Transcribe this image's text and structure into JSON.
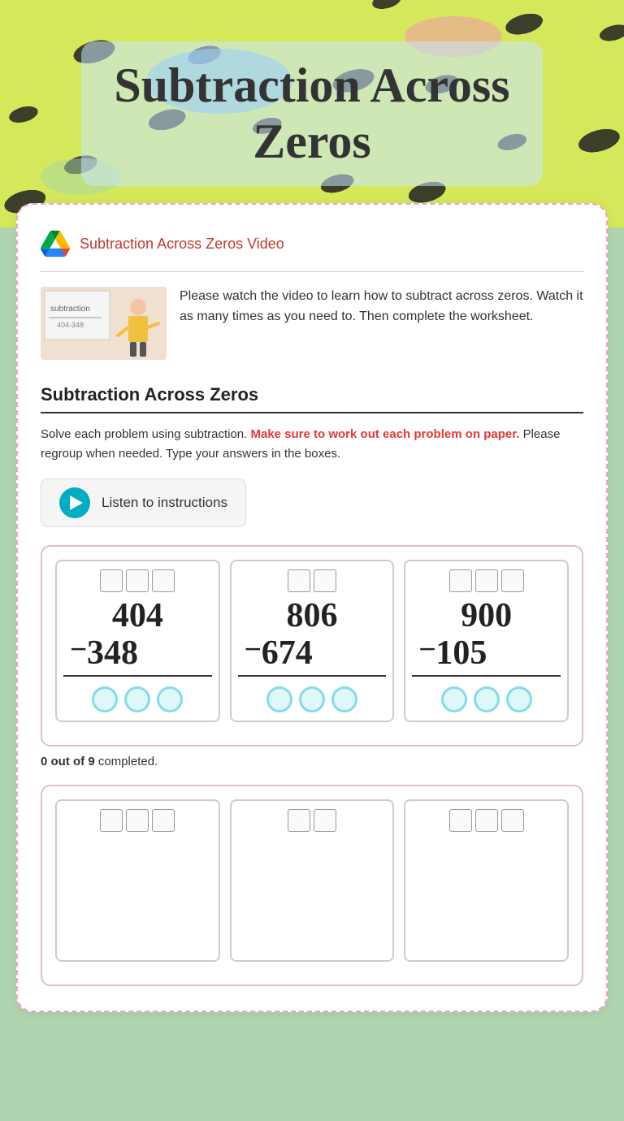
{
  "page": {
    "title": "Subtraction Across Zeros"
  },
  "hero": {
    "title_line1": "Subtraction Across",
    "title_line2": "Zeros"
  },
  "video_section": {
    "link_text": "Subtraction Across Zeros Video",
    "description": "Please watch the video to learn how to subtract across zeros. Watch it as many times as you need to. Then complete the worksheet."
  },
  "worksheet": {
    "title": "Subtraction Across Zeros",
    "instructions_part1": "Solve each problem using subtraction.",
    "instructions_highlight": "Make sure to work out each problem on paper.",
    "instructions_part2": "Please regroup when needed. Type your answers in the boxes.",
    "listen_button_label": "Listen to instructions",
    "completion_text_prefix": "0 out of 9",
    "completion_text_suffix": "completed."
  },
  "problems": [
    {
      "top": "404",
      "bottom": "348",
      "num_digits": 3
    },
    {
      "top": "806",
      "bottom": "674",
      "num_digits": 3
    },
    {
      "top": "900",
      "bottom": "105",
      "num_digits": 3
    }
  ],
  "icons": {
    "play": "▶",
    "drive": "google-drive-icon"
  }
}
